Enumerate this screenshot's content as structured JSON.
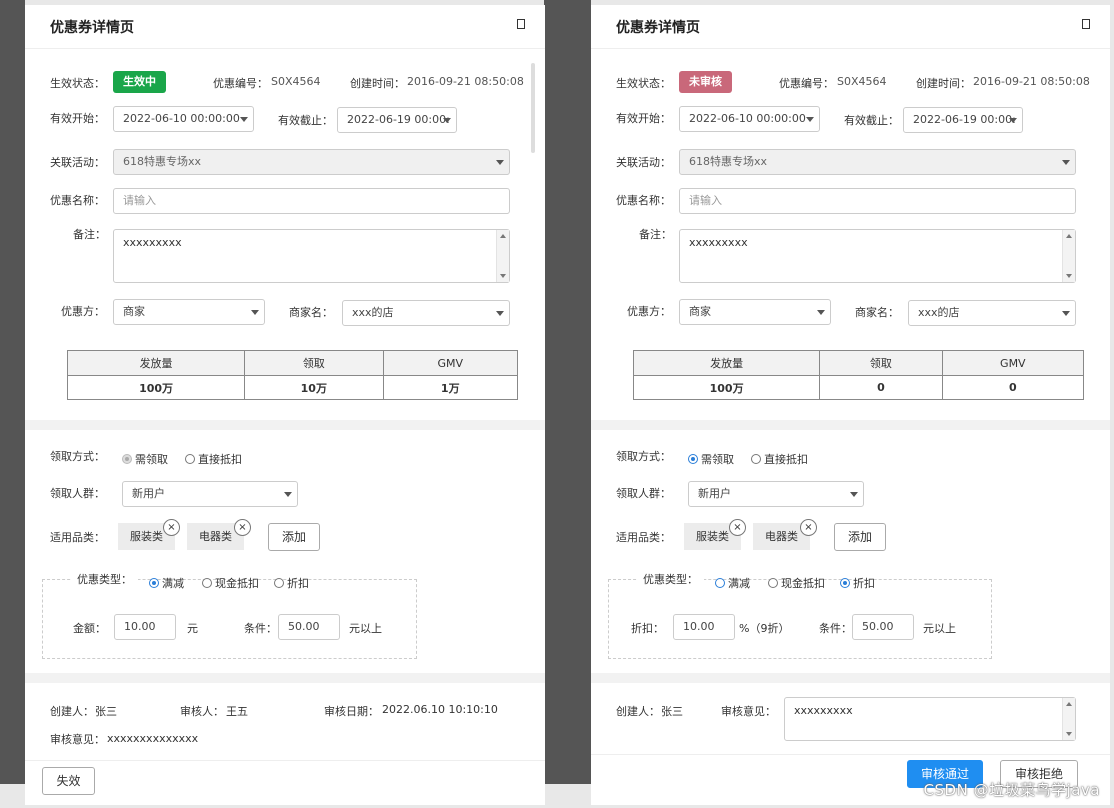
{
  "left": {
    "title": "优惠券详情页",
    "status_label": "生效状态：",
    "status_value": "生效中",
    "coupon_no_label": "优惠编号：",
    "coupon_no": "S0X4564",
    "created_label": "创建时间：",
    "created": "2016-09-21  08:50:08",
    "start_label": "有效开始：",
    "start_value": "2022-06-10  00:00:00",
    "end_label": "有效截止：",
    "end_value": "2022-06-19  00:00:",
    "activity_label": "关联活动：",
    "activity_value": "618特惠专场xx",
    "name_label": "优惠名称：",
    "name_placeholder": "请输入",
    "remark_label": "备注：",
    "remark_value": "xxxxxxxxx",
    "party_label": "优惠方：",
    "party_value": "商家",
    "merchant_label": "商家名：",
    "merchant_value": "xxx的店",
    "table": {
      "headers": [
        "发放量",
        "领取",
        "GMV"
      ],
      "row": [
        "100万",
        "10万",
        "1万"
      ]
    },
    "claim_label": "领取方式：",
    "claim_options": [
      "需领取",
      "直接抵扣"
    ],
    "crowd_label": "领取人群：",
    "crowd_value": "新用户",
    "category_label": "适用品类：",
    "categories": [
      "服装类",
      "电器类"
    ],
    "add_label": "添加",
    "type_label": "优惠类型：",
    "type_options": [
      "满减",
      "现金抵扣",
      "折扣"
    ],
    "amount_label": "金额：",
    "amount_value": "10.00",
    "amount_unit": "元",
    "cond_label": "条件：",
    "cond_value": "50.00",
    "cond_unit": "元以上",
    "creator_label": "创建人：",
    "creator": "张三",
    "reviewer_label": "审核人：",
    "reviewer": "王五",
    "review_date_label": "审核日期：",
    "review_date": "2022.06.10  10:10:10",
    "opinion_label": "审核意见：",
    "opinion": "xxxxxxxxxxxxxx",
    "invalid_btn": "失效"
  },
  "right": {
    "title": "优惠券详情页",
    "status_label": "生效状态：",
    "status_value": "未审核",
    "coupon_no_label": "优惠编号：",
    "coupon_no": "S0X4564",
    "created_label": "创建时间：",
    "created": "2016-09-21  08:50:08",
    "start_label": "有效开始：",
    "start_value": "2022-06-10  00:00:00",
    "end_label": "有效截止：",
    "end_value": "2022-06-19  00:00:",
    "activity_label": "关联活动：",
    "activity_value": "618特惠专场xx",
    "name_label": "优惠名称：",
    "name_placeholder": "请输入",
    "remark_label": "备注：",
    "remark_value": "xxxxxxxxx",
    "party_label": "优惠方：",
    "party_value": "商家",
    "merchant_label": "商家名：",
    "merchant_value": "xxx的店",
    "table": {
      "headers": [
        "发放量",
        "领取",
        "GMV"
      ],
      "row": [
        "100万",
        "0",
        "0"
      ]
    },
    "claim_label": "领取方式：",
    "claim_options": [
      "需领取",
      "直接抵扣"
    ],
    "crowd_label": "领取人群：",
    "crowd_value": "新用户",
    "category_label": "适用品类：",
    "categories": [
      "服装类",
      "电器类"
    ],
    "add_label": "添加",
    "type_label": "优惠类型：",
    "type_options": [
      "满减",
      "现金抵扣",
      "折扣"
    ],
    "discount_label": "折扣：",
    "discount_value": "10.00",
    "discount_unit": "%（9折）",
    "cond_label": "条件：",
    "cond_value": "50.00",
    "cond_unit": "元以上",
    "creator_label": "创建人：",
    "creator": "张三",
    "opinion_label": "审核意见：",
    "opinion": "xxxxxxxxx",
    "approve_btn": "审核通过",
    "reject_btn": "审核拒绝"
  },
  "watermark": "CSDN @垃圾菜鸟学java",
  "colors": {
    "active": "#1aa64a",
    "pending": "#c9687a",
    "primary": "#1f8ef1"
  }
}
